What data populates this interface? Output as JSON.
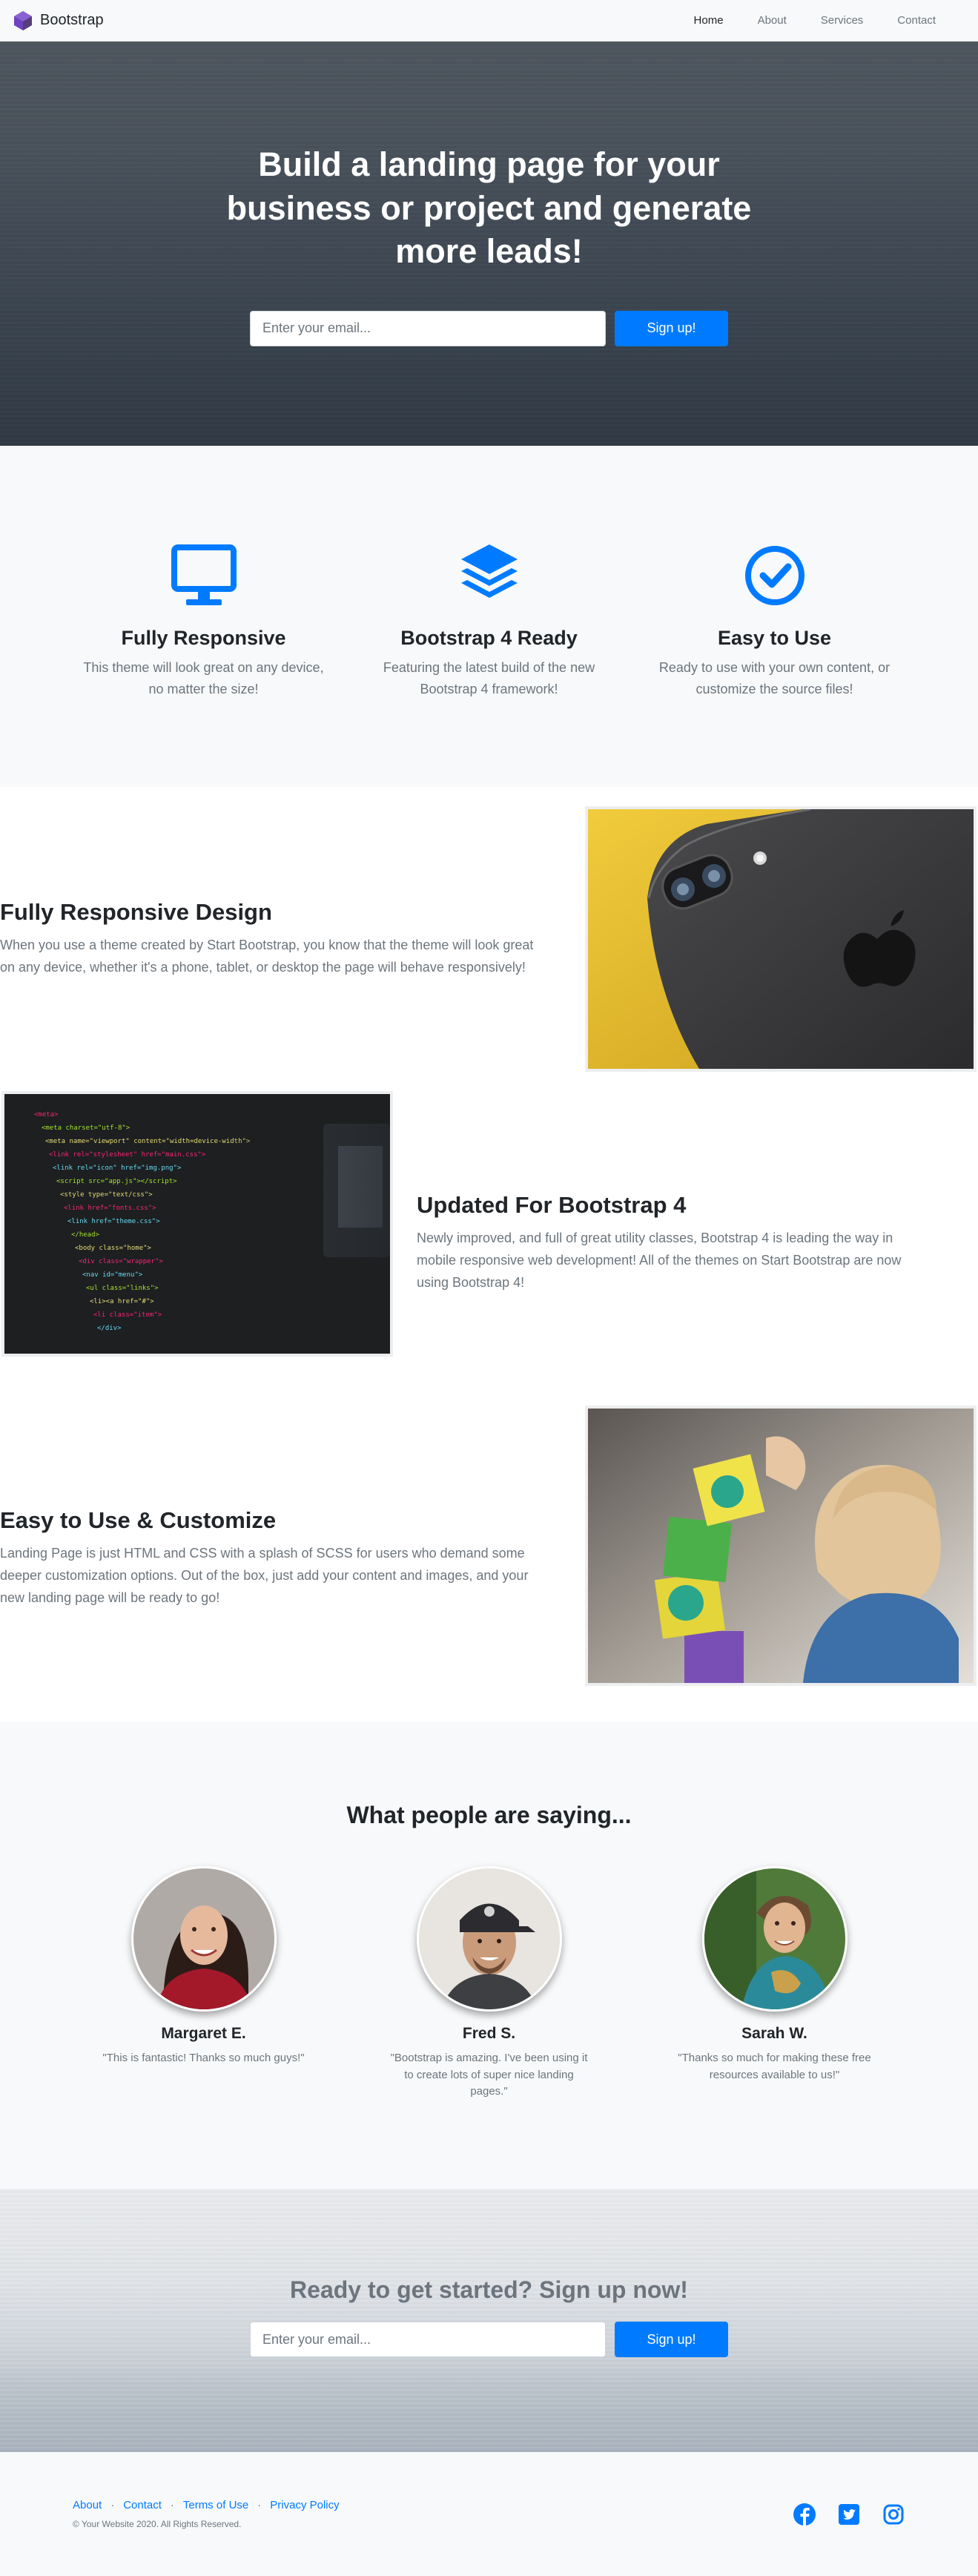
{
  "navbar": {
    "brand": "Bootstrap",
    "links": [
      "Home",
      "About",
      "Services",
      "Contact"
    ]
  },
  "masthead": {
    "heading": "Build a landing page for your business or project and generate more leads!",
    "email_placeholder": "Enter your email...",
    "signup_label": "Sign up!"
  },
  "features": [
    {
      "icon": "desktop-icon",
      "title": "Fully Responsive",
      "text": "This theme will look great on any device, no matter the size!"
    },
    {
      "icon": "layers-icon",
      "title": "Bootstrap 4 Ready",
      "text": "Featuring the latest build of the new Bootstrap 4 framework!"
    },
    {
      "icon": "check-circle-icon",
      "title": "Easy to Use",
      "text": "Ready to use with your own content, or customize the source files!"
    }
  ],
  "showcase": [
    {
      "title": "Fully Responsive Design",
      "text": "When you use a theme created by Start Bootstrap, you know that the theme will look great on any device, whether it's a phone, tablet, or desktop the page will behave responsively!"
    },
    {
      "title": "Updated For Bootstrap 4",
      "text": "Newly improved, and full of great utility classes, Bootstrap 4 is leading the way in mobile responsive web development! All of the themes on Start Bootstrap are now using Bootstrap 4!"
    },
    {
      "title": "Easy to Use & Customize",
      "text": "Landing Page is just HTML and CSS with a splash of SCSS for users who demand some deeper customization options. Out of the box, just add your content and images, and your new landing page will be ready to go!"
    }
  ],
  "testimonials": {
    "heading": "What people are saying...",
    "items": [
      {
        "name": "Margaret E.",
        "quote": "\"This is fantastic! Thanks so much guys!\""
      },
      {
        "name": "Fred S.",
        "quote": "\"Bootstrap is amazing. I've been using it to create lots of super nice landing pages.\""
      },
      {
        "name": "Sarah W.",
        "quote": "\"Thanks so much for making these free resources available to us!\""
      }
    ]
  },
  "cta": {
    "heading": "Ready to get started? Sign up now!",
    "email_placeholder": "Enter your email...",
    "signup_label": "Sign up!"
  },
  "footer": {
    "links": [
      "About",
      "Contact",
      "Terms of Use",
      "Privacy Policy"
    ],
    "separator": "·",
    "copyright": "© Your Website 2020. All Rights Reserved.",
    "social": [
      "facebook-icon",
      "twitter-icon",
      "instagram-icon"
    ]
  },
  "colors": {
    "primary": "#007bff",
    "light_bg": "#f8f9fa",
    "muted": "#6c757d",
    "dark": "#212529"
  }
}
